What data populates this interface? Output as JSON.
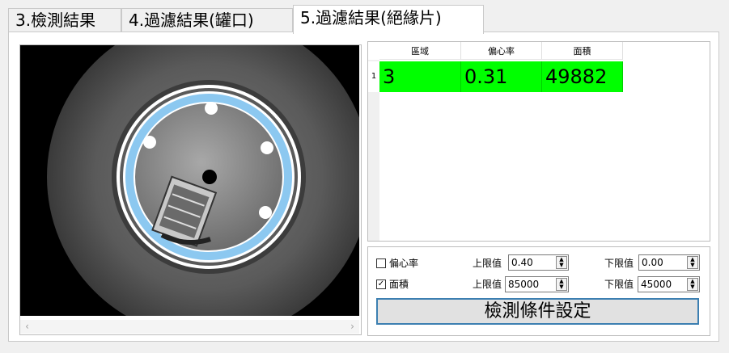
{
  "tabs": [
    {
      "label": "3.檢測結果"
    },
    {
      "label": "4.過濾結果(罐口)"
    },
    {
      "label": "5.過濾結果(絕緣片)"
    }
  ],
  "grid": {
    "columns": [
      "區域",
      "偏心率",
      "面積"
    ],
    "rows": [
      {
        "index": "1",
        "cells": [
          "3",
          "0.31",
          "49882"
        ]
      }
    ],
    "highlight_color": "#00ff00"
  },
  "filters": {
    "eccentricity": {
      "label": "偏心率",
      "checked": false,
      "upper_label": "上限值",
      "upper": "0.40",
      "lower_label": "下限值",
      "lower": "0.00"
    },
    "area": {
      "label": "面積",
      "checked": true,
      "upper_label": "上限值",
      "upper": "85000",
      "lower_label": "下限值",
      "lower": "45000"
    }
  },
  "buttons": {
    "set_conditions": "檢測條件設定"
  },
  "icons": {
    "scroll_left": "‹",
    "scroll_right": "›",
    "spin_up": "▲",
    "spin_down": "▼",
    "check": "✓"
  }
}
